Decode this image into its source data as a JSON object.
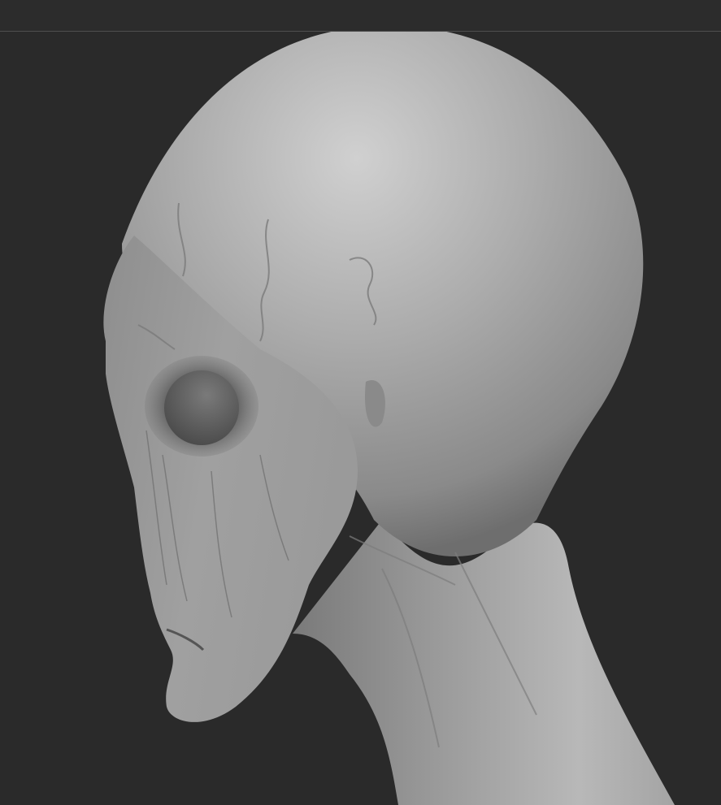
{
  "app": {
    "title": ""
  },
  "viewport": {
    "background_color": "#2a2a2a",
    "top_strip_color": "#2c2c2c",
    "divider_color": "#4e4e4e",
    "model": {
      "material_base_color": "#9a9a9a",
      "material_highlight_color": "#d2d2d2",
      "material_shadow_color": "#4a4a4a",
      "view": "profile-left"
    }
  }
}
